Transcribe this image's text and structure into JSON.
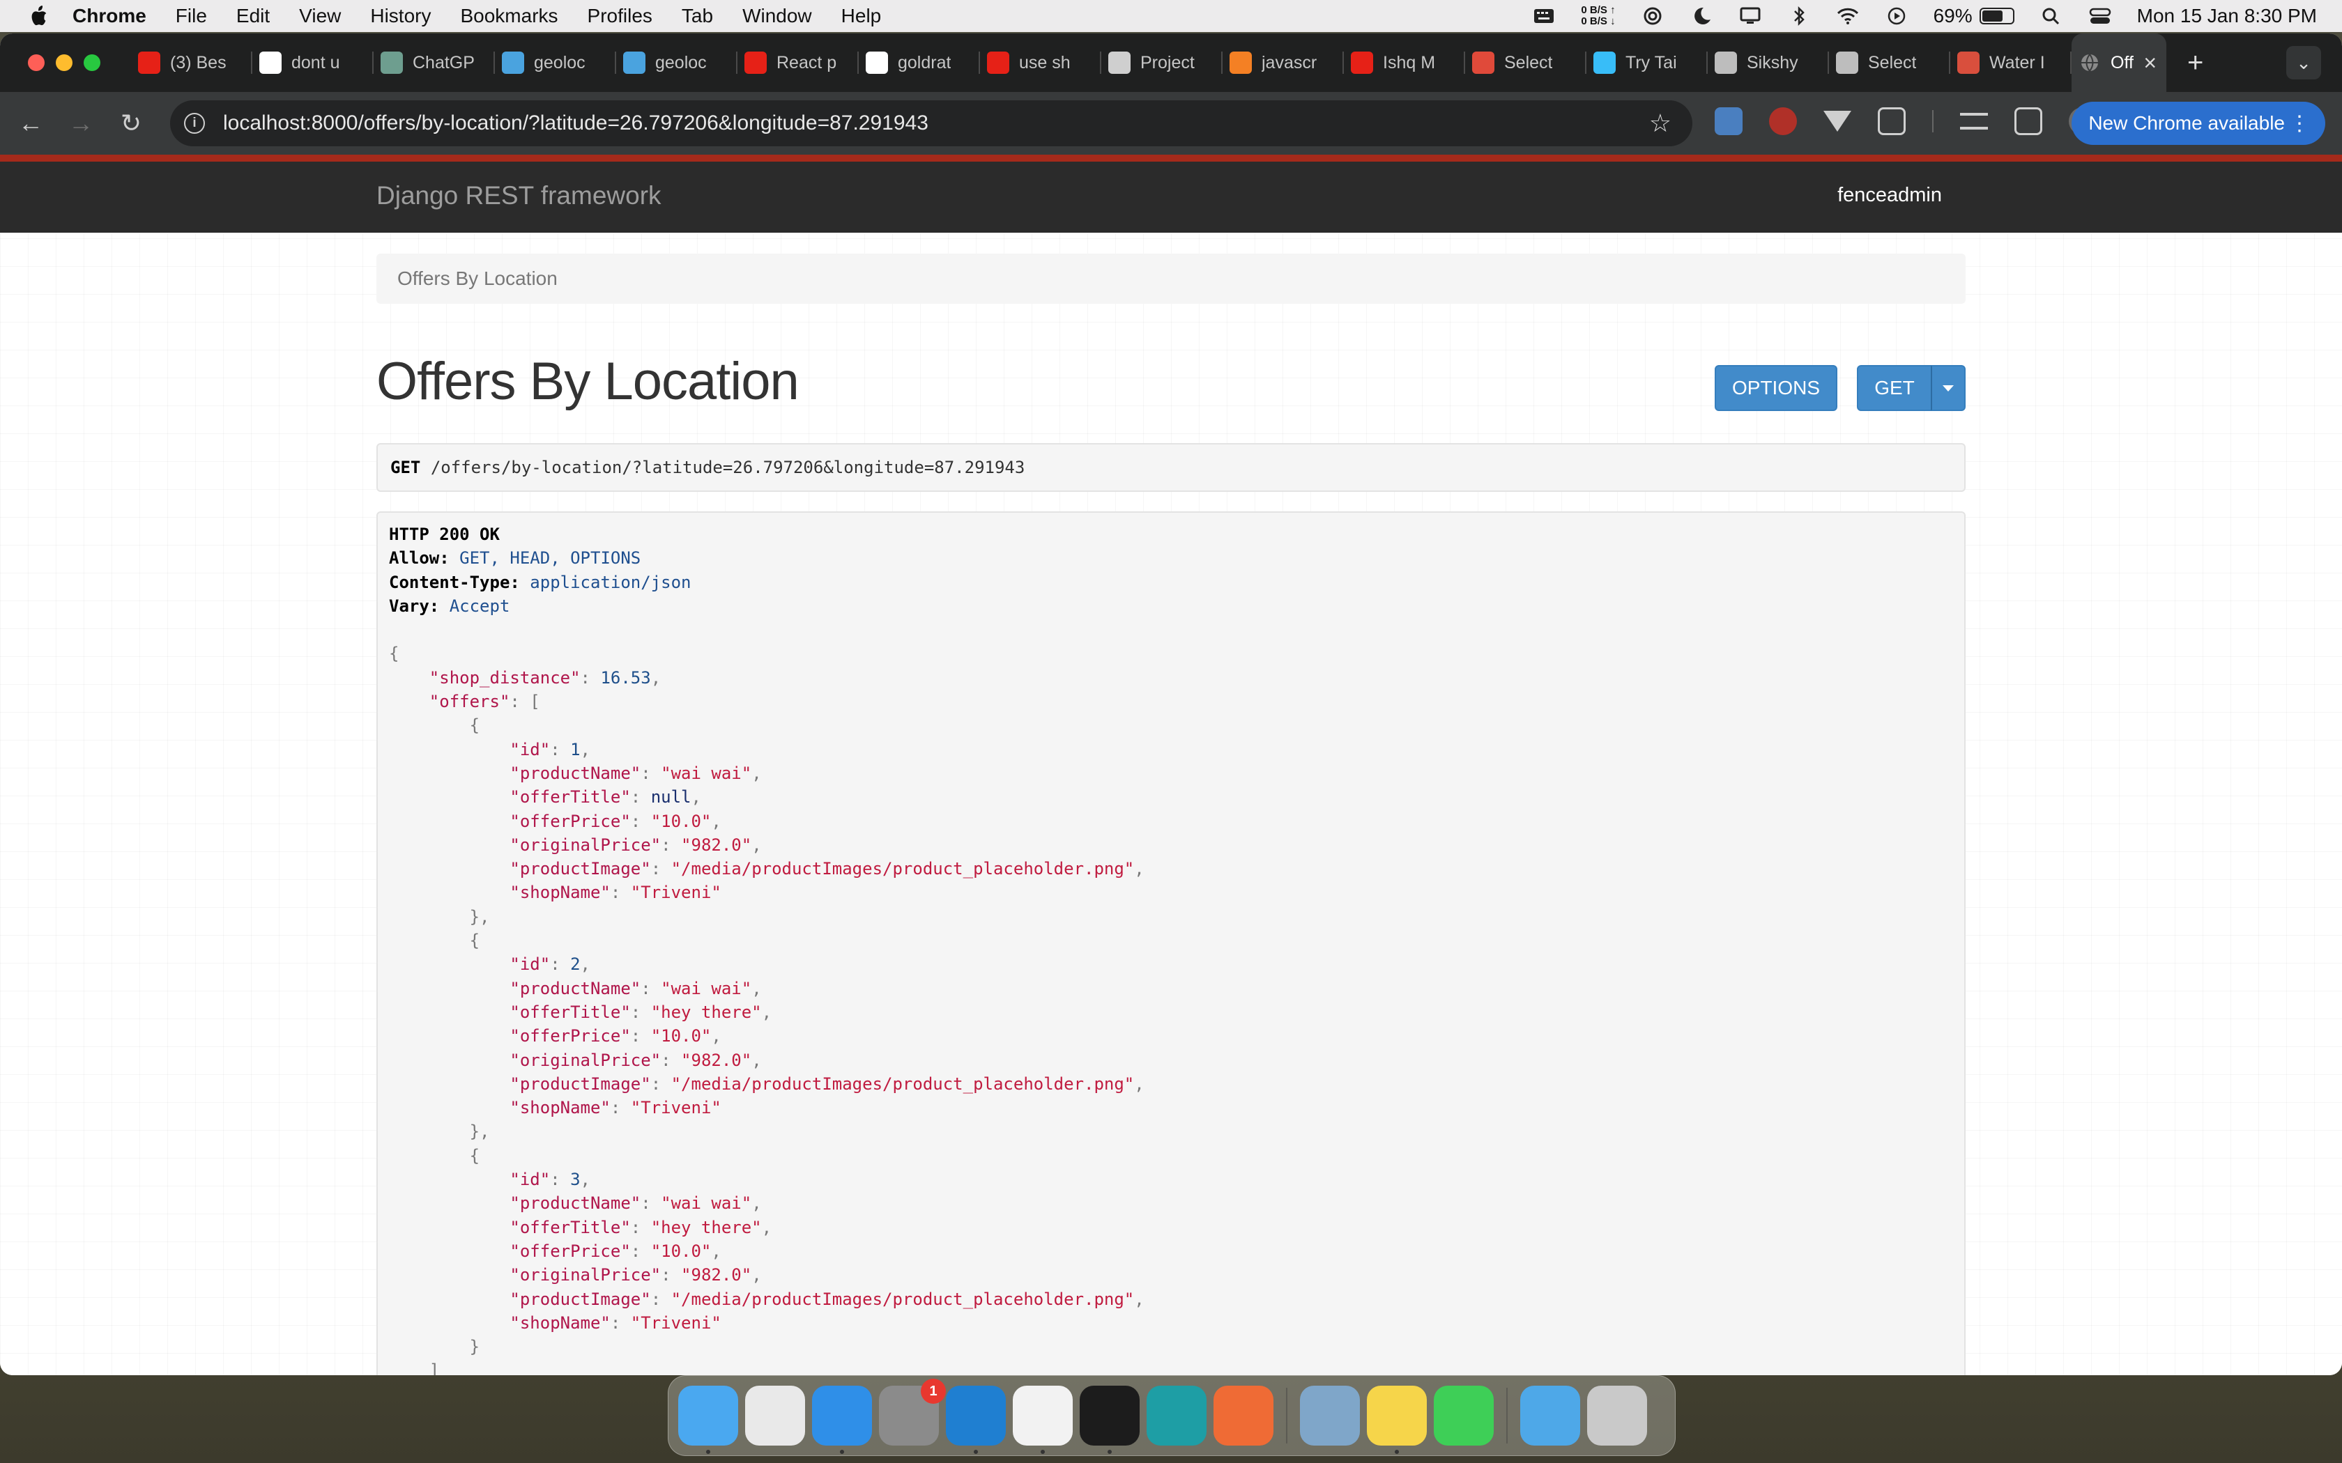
{
  "menubar": {
    "app_name": "Chrome",
    "items": [
      "File",
      "Edit",
      "View",
      "History",
      "Bookmarks",
      "Profiles",
      "Tab",
      "Window",
      "Help"
    ],
    "net_up": "0 B/S ↑",
    "net_down": "0 B/S ↓",
    "battery": "69%",
    "battery_level": 0.69,
    "clock": "Mon 15 Jan  8:30 PM"
  },
  "tabs": [
    {
      "title": "(3) Bes",
      "icon": "youtube-icon",
      "color": "#e62117"
    },
    {
      "title": "dont u",
      "icon": "google-icon",
      "color": "#ffffff"
    },
    {
      "title": "ChatGP",
      "icon": "chatgpt-icon",
      "color": "#6e9e8f"
    },
    {
      "title": "geoloc",
      "icon": "flutter-icon",
      "color": "#4aa3df"
    },
    {
      "title": "geoloc",
      "icon": "flutter-icon",
      "color": "#4aa3df"
    },
    {
      "title": "React p",
      "icon": "youtube-icon",
      "color": "#e62117"
    },
    {
      "title": "goldrat",
      "icon": "github-icon",
      "color": "#ffffff"
    },
    {
      "title": "use sh",
      "icon": "youtube-icon",
      "color": "#e62117"
    },
    {
      "title": "Project",
      "icon": "stack-icon",
      "color": "#cfcfcf"
    },
    {
      "title": "javascr",
      "icon": "stackoverflow-icon",
      "color": "#f48024"
    },
    {
      "title": "Ishq M",
      "icon": "youtube-icon",
      "color": "#e62117"
    },
    {
      "title": "Select",
      "icon": "app-icon",
      "color": "#e04a3a"
    },
    {
      "title": "Try Tai",
      "icon": "tailwind-icon",
      "color": "#38bdf8"
    },
    {
      "title": "Sikshy",
      "icon": "globe-icon",
      "color": "#bdbdbd"
    },
    {
      "title": "Select",
      "icon": "globe-icon",
      "color": "#bdbdbd"
    },
    {
      "title": "Water I",
      "icon": "app-icon",
      "color": "#d94f3d"
    }
  ],
  "active_tab": {
    "title": "Off",
    "close": "×"
  },
  "address_bar": {
    "url": "localhost:8000/offers/by-location/?latitude=26.797206&longitude=87.291943",
    "update_label": "New Chrome available"
  },
  "drf": {
    "brand": "Django REST framework",
    "user": "fenceadmin",
    "breadcrumb": "Offers By Location",
    "title": "Offers By Location",
    "options_label": "OPTIONS",
    "get_label": "GET",
    "request_method": "GET",
    "request_path": "/offers/by-location/?latitude=26.797206&longitude=87.291943"
  },
  "response": {
    "status": "HTTP 200 OK",
    "headers": [
      {
        "name": "Allow:",
        "value": "GET, HEAD, OPTIONS"
      },
      {
        "name": "Content-Type:",
        "value": "application/json"
      },
      {
        "name": "Vary:",
        "value": "Accept"
      }
    ],
    "body": {
      "shop_distance": 16.53,
      "offers": [
        {
          "id": 1,
          "productName": "wai wai",
          "offerTitle": null,
          "offerPrice": "10.0",
          "originalPrice": "982.0",
          "productImage": "/media/productImages/product_placeholder.png",
          "shopName": "Triveni"
        },
        {
          "id": 2,
          "productName": "wai wai",
          "offerTitle": "hey there",
          "offerPrice": "10.0",
          "originalPrice": "982.0",
          "productImage": "/media/productImages/product_placeholder.png",
          "shopName": "Triveni"
        },
        {
          "id": 3,
          "productName": "wai wai",
          "offerTitle": "hey there",
          "offerPrice": "10.0",
          "originalPrice": "982.0",
          "productImage": "/media/productImages/product_placeholder.png",
          "shopName": "Triveni"
        }
      ]
    }
  },
  "dock": [
    {
      "name": "finder-icon",
      "color": "#4aa8f0",
      "running": true
    },
    {
      "name": "launchpad-icon",
      "color": "#e9e9e9",
      "running": false
    },
    {
      "name": "safari-icon",
      "color": "#2f8fe8",
      "running": true
    },
    {
      "name": "system-settings-icon",
      "color": "#8b8b8b",
      "running": false,
      "badge": "1"
    },
    {
      "name": "vscode-icon",
      "color": "#1f7fd1",
      "running": true
    },
    {
      "name": "chrome-icon",
      "color": "#f2f2f2",
      "running": true
    },
    {
      "name": "terminal-icon",
      "color": "#1c1c1c",
      "running": true
    },
    {
      "name": "arduino-icon",
      "color": "#1e9ea5",
      "running": false
    },
    {
      "name": "postman-icon",
      "color": "#ef6b35",
      "running": false
    },
    {
      "name": "preview-icon",
      "color": "#7fa6c9",
      "running": false
    },
    {
      "name": "notes-icon",
      "color": "#f6d54a",
      "running": true
    },
    {
      "name": "messages-icon",
      "color": "#3ecf57",
      "running": false
    },
    {
      "name": "folder-icon",
      "color": "#4ea8e8",
      "running": false
    },
    {
      "name": "trash-icon",
      "color": "#c9c9c9",
      "running": false
    }
  ]
}
